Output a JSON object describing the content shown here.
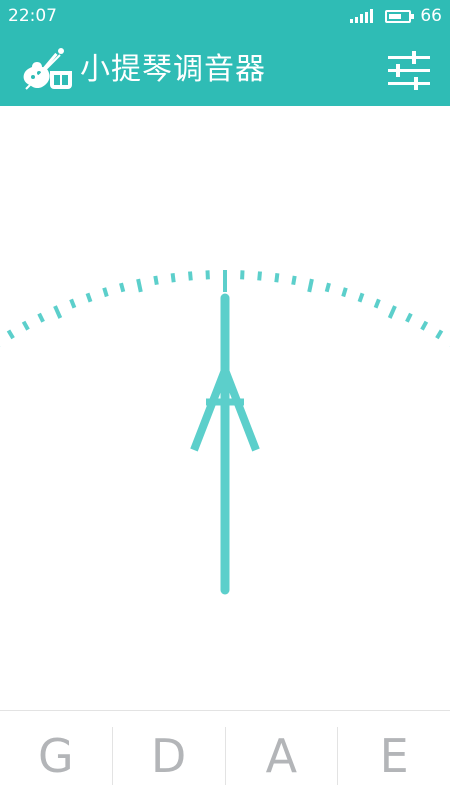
{
  "status_bar": {
    "time": "22:07",
    "battery_level": "66",
    "signal_icon": "signal-bars-icon",
    "battery_icon": "battery-icon"
  },
  "app_bar": {
    "title": "小提琴调音器",
    "logo_icon": "violin-icon",
    "settings_icon": "sliders-icon"
  },
  "tuner": {
    "needle_deviation": 0,
    "icons": {
      "needle": "needle-arrow-icon",
      "scale": "tuning-scale-icon"
    }
  },
  "strings": [
    {
      "label": "G"
    },
    {
      "label": "D"
    },
    {
      "label": "A"
    },
    {
      "label": "E"
    }
  ],
  "colors": {
    "accent": "#2fbcb5",
    "needle": "#5ccfcb",
    "string_text": "#b3b5b8",
    "divider": "#e3e3e3"
  }
}
